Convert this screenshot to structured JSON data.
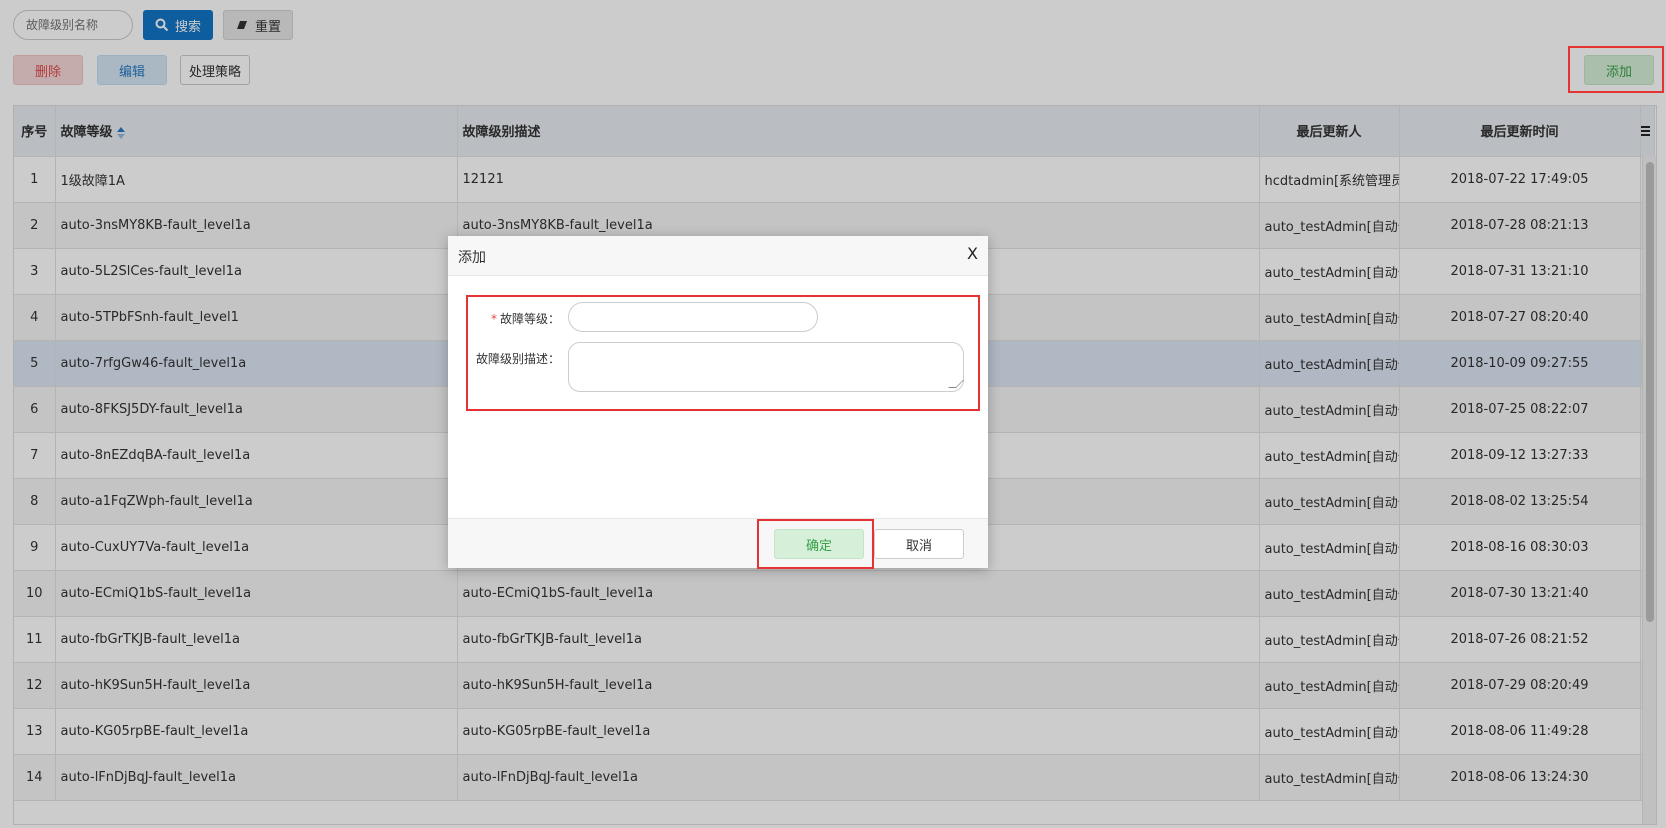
{
  "toolbar": {
    "search_placeholder": "故障级别名称",
    "search_label": "搜索",
    "reset_label": "重置",
    "delete_label": "删除",
    "edit_label": "编辑",
    "strategy_label": "处理策略",
    "add_label": "添加"
  },
  "table": {
    "headers": [
      "序号",
      "故障等级",
      "故障级别描述",
      "最后更新人",
      "最后更新时间"
    ],
    "rows": [
      {
        "no": "1",
        "level": "1级故障1A",
        "desc": "12121",
        "user": "hcdtadmin[系统管理员]",
        "time": "2018-07-22 17:49:05"
      },
      {
        "no": "2",
        "level": "auto-3nsMY8KB-fault_level1a",
        "desc": "auto-3nsMY8KB-fault_level1a",
        "user": "auto_testAdmin[自动化测",
        "time": "2018-07-28 08:21:13"
      },
      {
        "no": "3",
        "level": "auto-5L2SlCes-fault_level1a",
        "desc": "",
        "user": "auto_testAdmin[自动化测",
        "time": "2018-07-31 13:21:10"
      },
      {
        "no": "4",
        "level": "auto-5TPbFSnh-fault_level1",
        "desc": "",
        "user": "auto_testAdmin[自动化测",
        "time": "2018-07-27 08:20:40"
      },
      {
        "no": "5",
        "level": "auto-7rfgGw46-fault_level1a",
        "desc": "",
        "user": "auto_testAdmin[自动化测",
        "time": "2018-10-09 09:27:55"
      },
      {
        "no": "6",
        "level": "auto-8FKSJ5DY-fault_level1a",
        "desc": "",
        "user": "auto_testAdmin[自动化测",
        "time": "2018-07-25 08:22:07"
      },
      {
        "no": "7",
        "level": "auto-8nEZdqBA-fault_level1a",
        "desc": "",
        "user": "auto_testAdmin[自动化测",
        "time": "2018-09-12 13:27:33"
      },
      {
        "no": "8",
        "level": "auto-a1FqZWph-fault_level1a",
        "desc": "",
        "user": "auto_testAdmin[自动化测",
        "time": "2018-08-02 13:25:54"
      },
      {
        "no": "9",
        "level": "auto-CuxUY7Va-fault_level1a",
        "desc": "",
        "user": "auto_testAdmin[自动化测",
        "time": "2018-08-16 08:30:03"
      },
      {
        "no": "10",
        "level": "auto-ECmiQ1bS-fault_level1a",
        "desc": "auto-ECmiQ1bS-fault_level1a",
        "user": "auto_testAdmin[自动化测",
        "time": "2018-07-30 13:21:40"
      },
      {
        "no": "11",
        "level": "auto-fbGrTKJB-fault_level1a",
        "desc": "auto-fbGrTKJB-fault_level1a",
        "user": "auto_testAdmin[自动化测",
        "time": "2018-07-26 08:21:52"
      },
      {
        "no": "12",
        "level": "auto-hK9Sun5H-fault_level1a",
        "desc": "auto-hK9Sun5H-fault_level1a",
        "user": "auto_testAdmin[自动化测",
        "time": "2018-07-29 08:20:49"
      },
      {
        "no": "13",
        "level": "auto-KG05rpBE-fault_level1a",
        "desc": "auto-KG05rpBE-fault_level1a",
        "user": "auto_testAdmin[自动化测",
        "time": "2018-08-06 11:49:28"
      },
      {
        "no": "14",
        "level": "auto-lFnDjBqJ-fault_level1a",
        "desc": "auto-lFnDjBqJ-fault_level1a",
        "user": "auto_testAdmin[自动化测",
        "time": "2018-08-06 13:24:30"
      }
    ]
  },
  "dialog": {
    "title": "添加",
    "close": "X",
    "required_mark": "*",
    "level_label": "故障等级：",
    "desc_label": "故障级别描述：",
    "ok_label": "确定",
    "cancel_label": "取消"
  }
}
